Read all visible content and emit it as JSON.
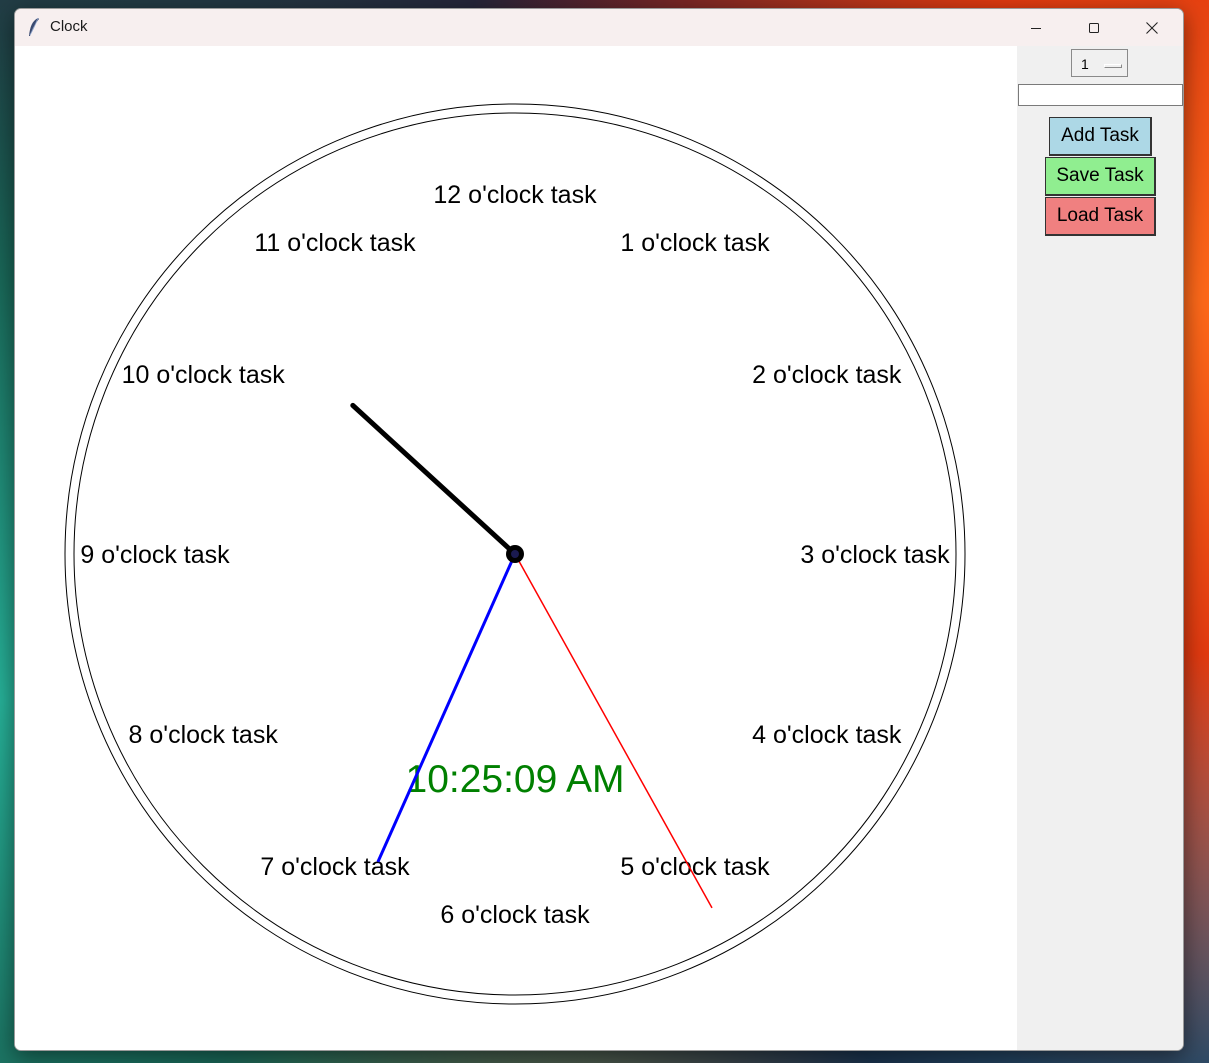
{
  "window": {
    "title": "Clock",
    "icon": "feather-icon",
    "controls": [
      "minimize-icon",
      "maximize-icon",
      "close-icon"
    ]
  },
  "clock": {
    "time_text": "10:25:09 AM",
    "time_color": "#008000",
    "hour": 10,
    "minute": 25,
    "second": 9,
    "hand_colors": {
      "hour": "#000000",
      "minute": "#ff0000",
      "second": "#0000ff"
    },
    "labels": [
      {
        "hour": 12,
        "text": "12 o'clock task"
      },
      {
        "hour": 1,
        "text": "1 o'clock task"
      },
      {
        "hour": 2,
        "text": "2 o'clock task"
      },
      {
        "hour": 3,
        "text": "3 o'clock task"
      },
      {
        "hour": 4,
        "text": "4 o'clock task"
      },
      {
        "hour": 5,
        "text": "5 o'clock task"
      },
      {
        "hour": 6,
        "text": "6 o'clock task"
      },
      {
        "hour": 7,
        "text": "7 o'clock task"
      },
      {
        "hour": 8,
        "text": "8 o'clock task"
      },
      {
        "hour": 9,
        "text": "9 o'clock task"
      },
      {
        "hour": 10,
        "text": "10 o'clock task"
      },
      {
        "hour": 11,
        "text": "11 o'clock task"
      }
    ]
  },
  "controls": {
    "hour_select_value": "1",
    "task_input_value": "",
    "add_label": "Add Task",
    "save_label": "Save Task",
    "load_label": "Load Task",
    "add_color": "#add8e6",
    "save_color": "#90ee90",
    "load_color": "#f08080"
  }
}
